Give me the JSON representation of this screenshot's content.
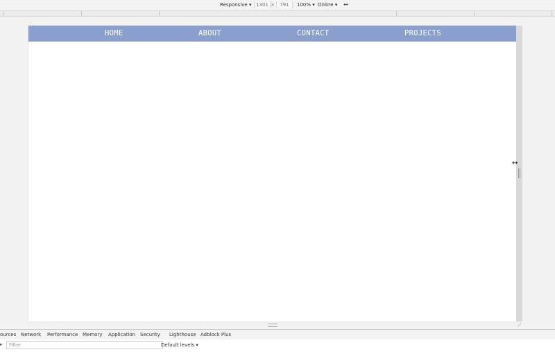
{
  "device_toolbar": {
    "mode": "Responsive",
    "width": "1301",
    "times": "×",
    "height": "791",
    "zoom": "100%",
    "throttle": "Online",
    "dropdown_glyph": "▾",
    "rotate_icon": "⟲"
  },
  "page": {
    "nav": {
      "background": "#8a9fce",
      "home": "HOME",
      "about": "ABOUT",
      "contact": "CONTACT",
      "projects": "PROJECTS"
    }
  },
  "devtools": {
    "tabs": [
      "ources",
      "Network",
      "Performance",
      "Memory",
      "Application",
      "Security",
      "Lighthouse",
      "Adblock Plus"
    ],
    "filter_placeholder": "Filter",
    "levels": "Default levels"
  },
  "icons": {
    "resize_cursor": "↔",
    "corner": "⟋",
    "edge": "▸"
  }
}
